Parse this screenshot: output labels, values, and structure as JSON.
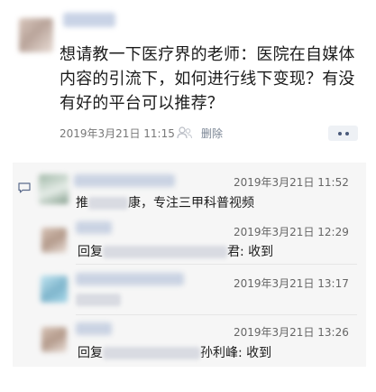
{
  "post": {
    "text": "想请教一下医疗界的老师：医院在自媒体内容的引流下，如何进行线下变现？有没有好的平台可以推荐？",
    "time": "2019年3月21日 11:15",
    "delete_label": "删除"
  },
  "comments": [
    {
      "time": "2019年3月21日 11:52",
      "text_pre": "推",
      "text_post": "康，专注三甲科普视频"
    },
    {
      "time": "2019年3月21日 12:29",
      "reply_prefix": "回复",
      "reply_mid": "君",
      "reply_suffix": ": 收到"
    },
    {
      "time": "2019年3月21日 13:17"
    },
    {
      "time": "2019年3月21日 13:26",
      "reply_prefix": "回复",
      "reply_mid": "孙利峰",
      "reply_suffix": ": 收到"
    }
  ],
  "icons": {
    "like": "like-icon",
    "comment": "comment-icon",
    "more": "more-icon"
  }
}
